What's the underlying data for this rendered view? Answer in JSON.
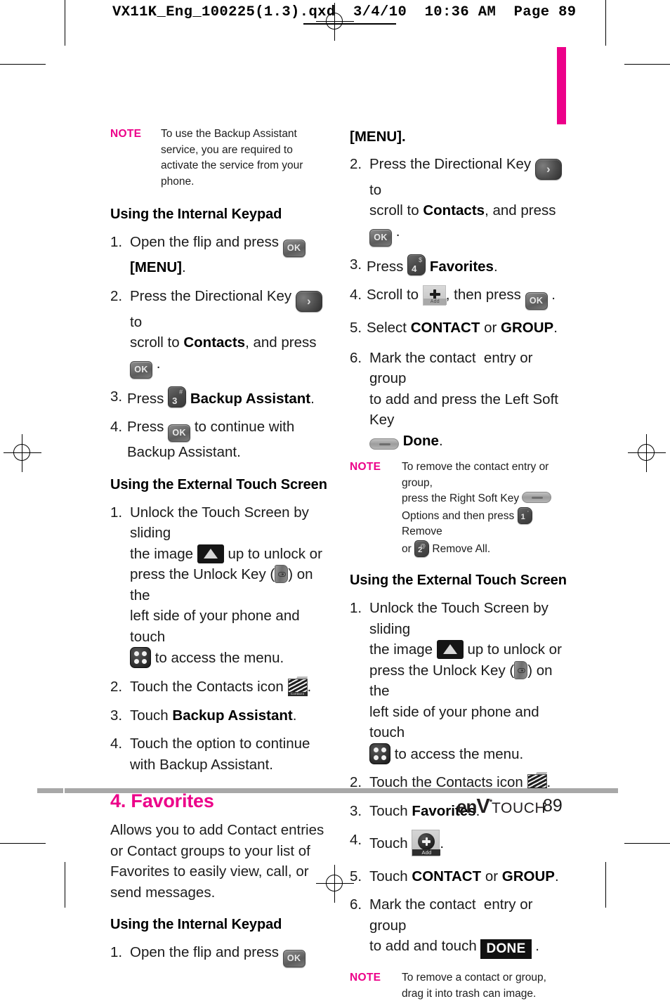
{
  "colors": {
    "pink": "#EC0089",
    "note_keyword": "#EC0089",
    "heading_pink": "#EC0089",
    "text": "#1D1D1D",
    "footer_bar": "#A8A8A8"
  },
  "prepress": {
    "header_line": "VX11K_Eng_100225(1.3).qxd  3/4/10  10:36 AM  Page 89"
  },
  "left_column": {
    "note_top": {
      "keyword": "NOTE",
      "text": "To use the Backup Assistant service, you are required to activate the service from your phone."
    },
    "heading_internal": "Using the Internal Keypad",
    "steps_internal": [
      {
        "num": "1.",
        "text_a": "Open the flip and press",
        "key": "OK",
        "text_b": "[MENU].",
        "bold_b": "[MENU]"
      },
      {
        "num": "2.",
        "text_a": "Press the Directional Key",
        "key": "directional",
        "text_b": "to scroll to",
        "bold": "Contacts",
        "text_c": ", and press",
        "key2": "OK",
        "text_d": "."
      },
      {
        "num": "3.",
        "text_a": "Press",
        "key_num": "3",
        "key_sup": "#",
        "bold": "Backup Assistant",
        "text_b": "."
      },
      {
        "num": "4.",
        "text_a": "Press",
        "key": "OK",
        "text_b": "to continue with Backup Assistant."
      }
    ],
    "heading_touch": "Using the External Touch Screen",
    "steps_touch": [
      {
        "num": "1.",
        "text_a": "Unlock the Touch Screen by sliding the image",
        "icon_a": "slide-up-icon",
        "text_b": "up to unlock or press the Unlock Key (",
        "icon_b": "unlock-key-icon",
        "text_c": ") on the left side of your phone and touch",
        "icon_c": "menu-grid-icon",
        "text_d": "to access the menu."
      },
      {
        "num": "2.",
        "text_a": "Touch the Contacts icon",
        "icon": "contacts-icon",
        "text_b": "."
      },
      {
        "num": "3.",
        "text_a": "Touch",
        "bold": "Backup Assistant",
        "text_b": "."
      },
      {
        "num": "4.",
        "text_a": "Touch the option to continue with Backup Assistant."
      }
    ],
    "section_heading": "4. Favorites",
    "section_body": "Allows you to add Contact entries or Contact groups to your list of Favorites to easily view, call, or send messages.",
    "heading_internal2": "Using the Internal Keypad",
    "step_last": {
      "num": "1.",
      "text_a": "Open the flip and press",
      "key": "OK"
    }
  },
  "right_column": {
    "continuation": "[MENU].",
    "steps_internal": [
      {
        "num": "2.",
        "text_a": "Press the Directional Key",
        "key": "directional",
        "text_b": "to scroll to",
        "bold": "Contacts",
        "text_c": ", and press",
        "key2": "OK",
        "text_d": "."
      },
      {
        "num": "3.",
        "text_a": "Press",
        "key_num": "4",
        "key_sup": "$",
        "bold": "Favorites",
        "text_b": "."
      },
      {
        "num": "4.",
        "text_a": "Scroll to",
        "icon": "add-icon",
        "text_b": ", then press",
        "key2": "OK",
        "text_c": "."
      },
      {
        "num": "5.",
        "text_a": "Select",
        "bold_a": "CONTACT",
        "text_b": "or",
        "bold_b": "GROUP",
        "text_c": "."
      },
      {
        "num": "6.",
        "text_a": "Mark the contact  entry or group to add and press the Left Soft Key",
        "icon": "soft-key-icon",
        "bold": "Done",
        "text_b": "."
      }
    ],
    "note_mid": {
      "keyword": "NOTE",
      "text_a": "To remove the contact entry or group, press the Right Soft Key",
      "icon_a": "soft-key-icon",
      "text_b": "Options and then press",
      "key_1": "1",
      "key_1_sup": "'",
      "text_c": "Remove or",
      "key_2": "2",
      "key_2_sup": "@",
      "text_d": "Remove All."
    },
    "heading_touch": "Using the External Touch Screen",
    "steps_touch": [
      {
        "num": "1.",
        "text_a": "Unlock the Touch Screen by sliding the image",
        "icon_a": "slide-up-icon",
        "text_b": "up to unlock or press the Unlock Key (",
        "icon_b": "unlock-key-icon",
        "text_c": ") on the left side of your phone and touch",
        "icon_c": "menu-grid-icon",
        "text_d": "to access the menu."
      },
      {
        "num": "2.",
        "text_a": "Touch the Contacts icon",
        "icon": "contacts-icon",
        "text_b": "."
      },
      {
        "num": "3.",
        "text_a": "Touch",
        "bold": "Favorites",
        "text_b": "."
      },
      {
        "num": "4.",
        "text_a": "Touch",
        "icon": "add-touch-icon",
        "text_b": "."
      },
      {
        "num": "5.",
        "text_a": "Touch",
        "bold_a": "CONTACT",
        "text_b": "or",
        "bold_b": "GROUP",
        "text_c": "."
      },
      {
        "num": "6.",
        "text_a": "Mark the contact  entry or group to add and touch",
        "chip": "DONE",
        "text_b": "."
      }
    ],
    "note_bottom": {
      "keyword": "NOTE",
      "text": "To remove a contact or group, drag it into trash can image."
    }
  },
  "footer": {
    "logo_en": "en",
    "logo_v": "V",
    "logo_star": "*",
    "logo_touch": "TOUCH",
    "page_number": "89"
  }
}
